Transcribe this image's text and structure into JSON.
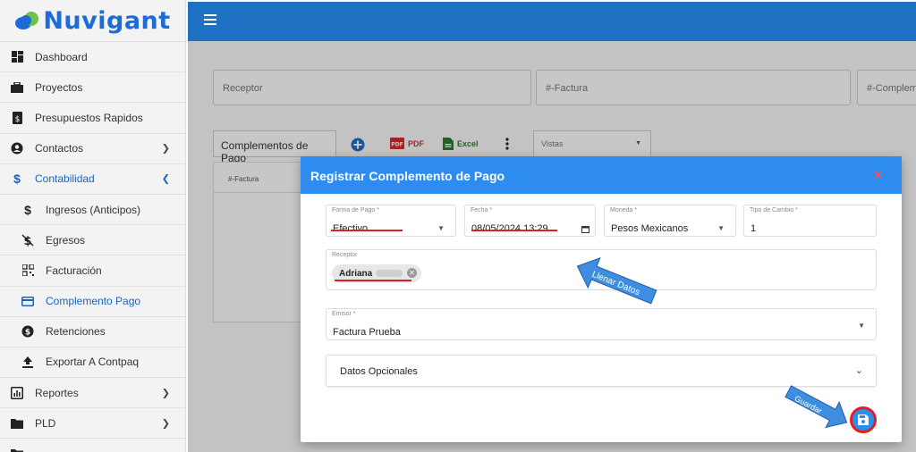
{
  "brand": {
    "name": "Nuvigant"
  },
  "sidebar": {
    "items": [
      {
        "label": "Dashboard",
        "icon": "dashboard-icon"
      },
      {
        "label": "Proyectos",
        "icon": "briefcase-icon"
      },
      {
        "label": "Presupuestos Rapidos",
        "icon": "document-dollar-icon"
      },
      {
        "label": "Contactos",
        "icon": "contacts-icon",
        "expandable": true
      },
      {
        "label": "Contabilidad",
        "icon": "dollar-icon",
        "expanded": true
      },
      {
        "label": "Ingresos (Anticipos)",
        "icon": "dollar-icon",
        "sub": true
      },
      {
        "label": "Egresos",
        "icon": "dollar-off-icon",
        "sub": true
      },
      {
        "label": "Facturación",
        "icon": "qr-icon",
        "sub": true
      },
      {
        "label": "Complemento Pago",
        "icon": "credit-card-icon",
        "sub": true,
        "active": true
      },
      {
        "label": "Retenciones",
        "icon": "coin-icon",
        "sub": true
      },
      {
        "label": "Exportar A Contpaq",
        "icon": "upload-icon",
        "sub": true
      },
      {
        "label": "Reportes",
        "icon": "chart-icon",
        "expandable": true
      },
      {
        "label": "PLD",
        "icon": "folder-icon",
        "expandable": true
      }
    ]
  },
  "filters": {
    "receptor": "Receptor",
    "factura": "#-Factura",
    "complemento": "#-Complemento"
  },
  "toolbar": {
    "tab_label": "Complementos de Pago",
    "pdf_label": "PDF",
    "excel_label": "Excel",
    "vistas_label": "Vistas"
  },
  "table": {
    "header": "#-Factura"
  },
  "modal": {
    "title": "Registrar Complemento de Pago",
    "forma_pago": {
      "label": "Forma de Pago *",
      "value": "Efectivo"
    },
    "fecha": {
      "label": "Fecha *",
      "value": "08/05/2024 13:29"
    },
    "moneda": {
      "label": "Moneda *",
      "value": "Pesos Mexicanos"
    },
    "tipo_cambio": {
      "label": "Tipo de Cambio *",
      "value": "1"
    },
    "receptor": {
      "label": "Receptor",
      "chip": "Adriana"
    },
    "emisor": {
      "label": "Emisor *",
      "value": "Factura Prueba"
    },
    "opcionales": "Datos Opcionales"
  },
  "annotations": {
    "llenar": "Llenar Datos",
    "guardar": "Guardar"
  },
  "colors": {
    "primary": "#1f71c4",
    "modal_header": "#2e8bef",
    "highlight": "#e02020",
    "active": "#1565c0"
  }
}
